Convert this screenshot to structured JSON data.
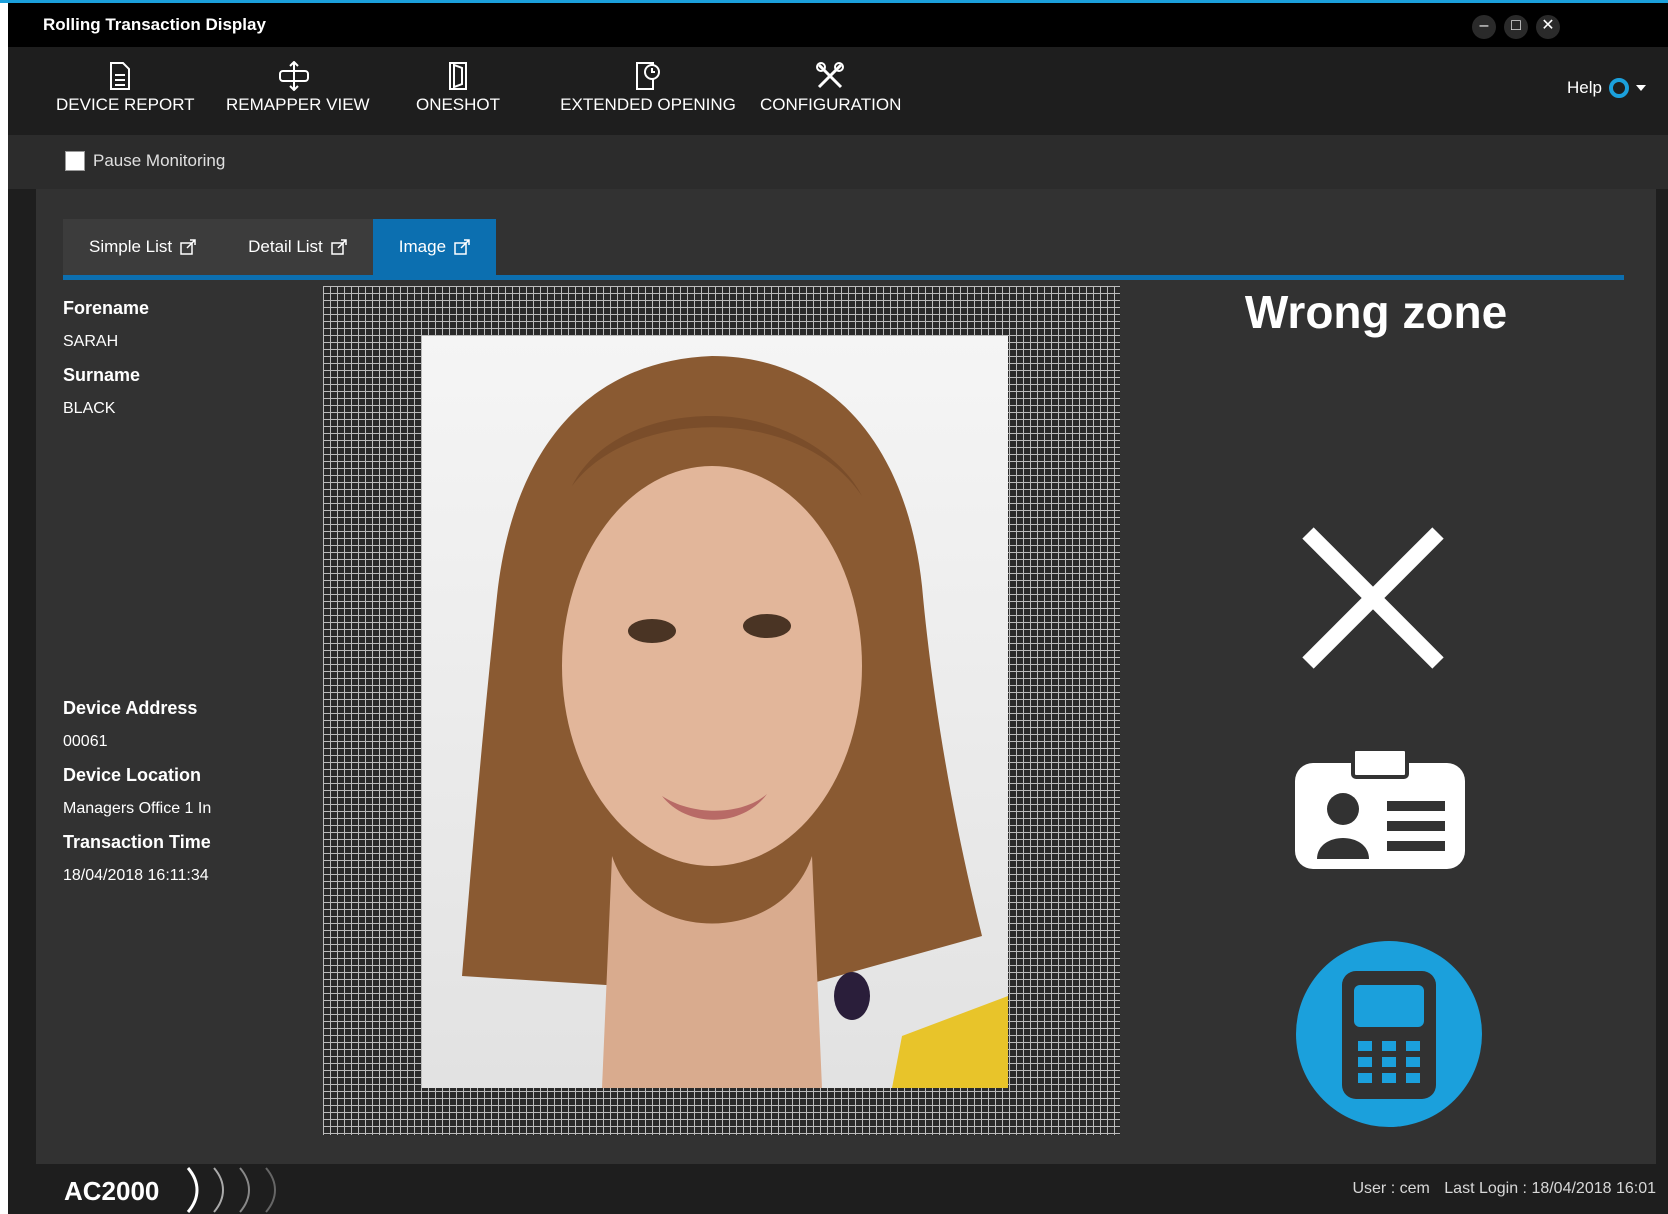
{
  "window": {
    "title": "Rolling Transaction Display"
  },
  "toolbar": {
    "items": [
      {
        "label": "DEVICE REPORT",
        "icon": "document-icon"
      },
      {
        "label": "REMAPPER VIEW",
        "icon": "remap-arrows-icon"
      },
      {
        "label": "ONESHOT",
        "icon": "door-icon"
      },
      {
        "label": "EXTENDED OPENING",
        "icon": "door-timer-icon"
      },
      {
        "label": "CONFIGURATION",
        "icon": "tools-icon"
      }
    ],
    "help_label": "Help"
  },
  "subbar": {
    "pause_label": "Pause Monitoring"
  },
  "tabs": [
    {
      "label": "Simple List",
      "active": false
    },
    {
      "label": "Detail List",
      "active": false
    },
    {
      "label": "Image",
      "active": true
    }
  ],
  "person": {
    "forename_label": "Forename",
    "forename": "SARAH",
    "surname_label": "Surname",
    "surname": "BLACK"
  },
  "device": {
    "address_label": "Device Address",
    "address": "00061",
    "location_label": "Device Location",
    "location": "Managers Office 1 In",
    "time_label": "Transaction Time",
    "time": "18/04/2018 16:11:34"
  },
  "status": {
    "title": "Wrong zone",
    "icons": [
      "cross-icon",
      "id-badge-icon",
      "keypad-icon"
    ],
    "keypad_color": "#1ba0dc"
  },
  "footer": {
    "logo": "AC2000",
    "user": "User : cem",
    "last_login": "Last Login : 18/04/2018 16:01"
  },
  "colors": {
    "accent": "#0c6fb0",
    "highlight": "#1ba0dc"
  }
}
